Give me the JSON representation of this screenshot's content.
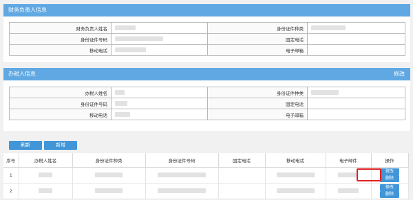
{
  "finance_section": {
    "title": "财务负责人信息",
    "rows": [
      {
        "left_label": "财务负责人姓名",
        "right_label": "身份证件种类"
      },
      {
        "left_label": "身份证件号码",
        "right_label": "固定电话"
      },
      {
        "left_label": "移动电话",
        "right_label": "电子邮箱"
      }
    ]
  },
  "tax_agent_section": {
    "title": "办税人信息",
    "edit_label": "修改",
    "rows": [
      {
        "left_label": "办税人姓名",
        "right_label": "身份证件种类"
      },
      {
        "left_label": "身份证件号码",
        "right_label": "固定电话"
      },
      {
        "left_label": "移动电话",
        "right_label": "电子邮箱"
      }
    ]
  },
  "toolbar": {
    "refresh_label": "刷新",
    "add_label": "新增"
  },
  "list": {
    "headers": [
      "序号",
      "办税人姓名",
      "身份证件种类",
      "身份证件号码",
      "固定电话",
      "移动电话",
      "电子邮件",
      "操作"
    ],
    "rows": [
      {
        "index": "1",
        "edit_label": "修改",
        "delete_label": "删除"
      },
      {
        "index": "2",
        "edit_label": "修改",
        "delete_label": "删除"
      }
    ]
  },
  "colors": {
    "header_bg": "#5fa8e3",
    "button_bg": "#4196d8",
    "highlight": "#e02020"
  }
}
